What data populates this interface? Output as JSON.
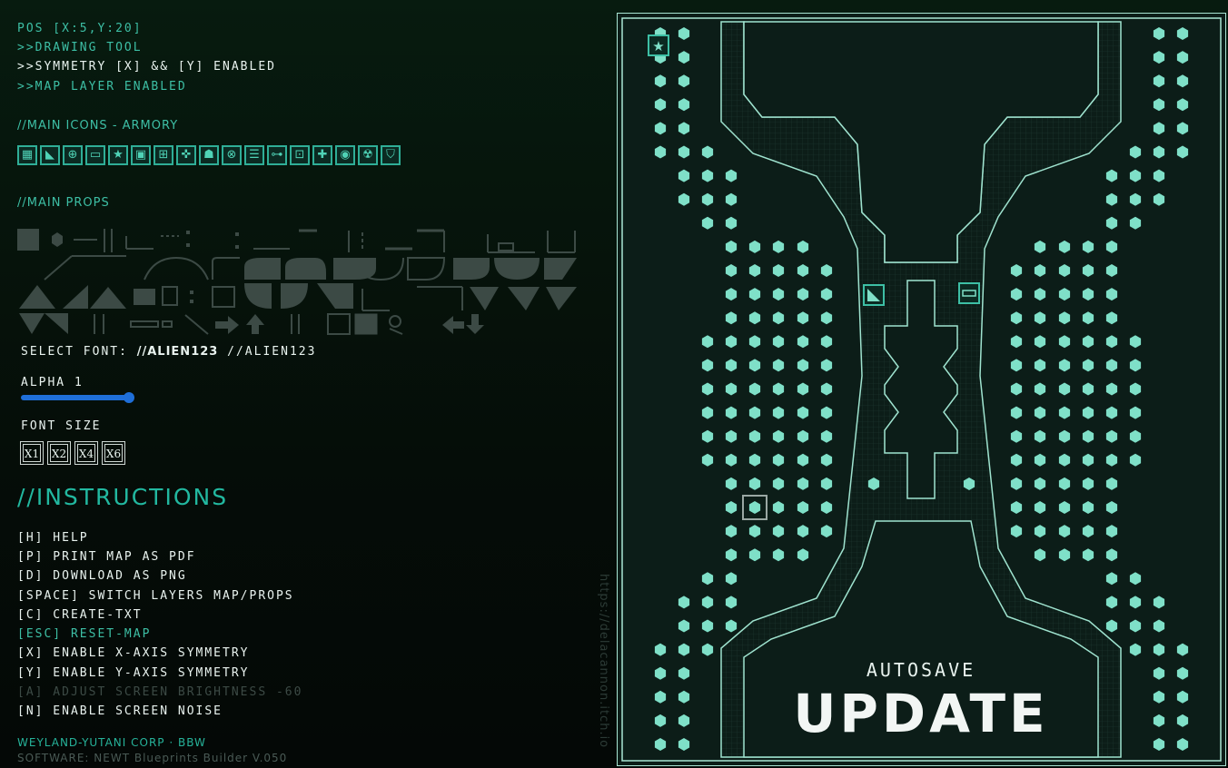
{
  "status": {
    "pos": "POS [X:5,Y:20]",
    "tool": ">>DRAWING TOOL",
    "symmetry": ">>SYMMETRY [X] && [Y] ENABLED",
    "layer": ">>MAP LAYER ENABLED"
  },
  "armory": {
    "heading": "//MAIN ICONS - ARMORY",
    "icons": [
      "grid-panel",
      "ramp",
      "target",
      "bed",
      "star",
      "screen",
      "terminal",
      "crosshair",
      "person",
      "fan",
      "shelves",
      "network",
      "lock",
      "medical",
      "eye",
      "hazard",
      "shield"
    ]
  },
  "props": {
    "heading": "//MAIN PROPS"
  },
  "font": {
    "label": "SELECT FONT: ",
    "option1": "//ALIEN123",
    "option2": " //ALIEN123"
  },
  "alpha": {
    "label": "ALPHA 1",
    "value": 1
  },
  "font_size": {
    "label": "FONT SIZE",
    "options": [
      "X1",
      "X2",
      "X4",
      "X6"
    ]
  },
  "instructions": {
    "heading": "//INSTRUCTIONS",
    "items": [
      "[H] HELP",
      "[P] PRINT MAP AS PDF",
      "[D] DOWNLOAD AS PNG",
      "[SPACE] SWITCH LAYERS MAP/PROPS",
      "[C] CREATE-TXT",
      "[ESC] RESET-MAP",
      "[X] ENABLE X-AXIS SYMMETRY",
      "[Y] ENABLE Y-AXIS SYMMETRY",
      "[A] ADJUST SCREEN BRIGHTNESS -60",
      "[N] ENABLE SCREEN NOISE"
    ]
  },
  "footer": {
    "company": "WEYLAND-YUTANI CORP · BBW",
    "software": "SOFTWARE: NEWT Blueprints Builder V.050"
  },
  "side_url": "https://delacannon.itch.io",
  "map": {
    "autosave_label": "AUTOSAVE",
    "update_label": "UPDATE"
  },
  "colors": {
    "accent": "#3dbfa5",
    "map_bg": "#0e211c",
    "dot": "#7fe0c8"
  }
}
